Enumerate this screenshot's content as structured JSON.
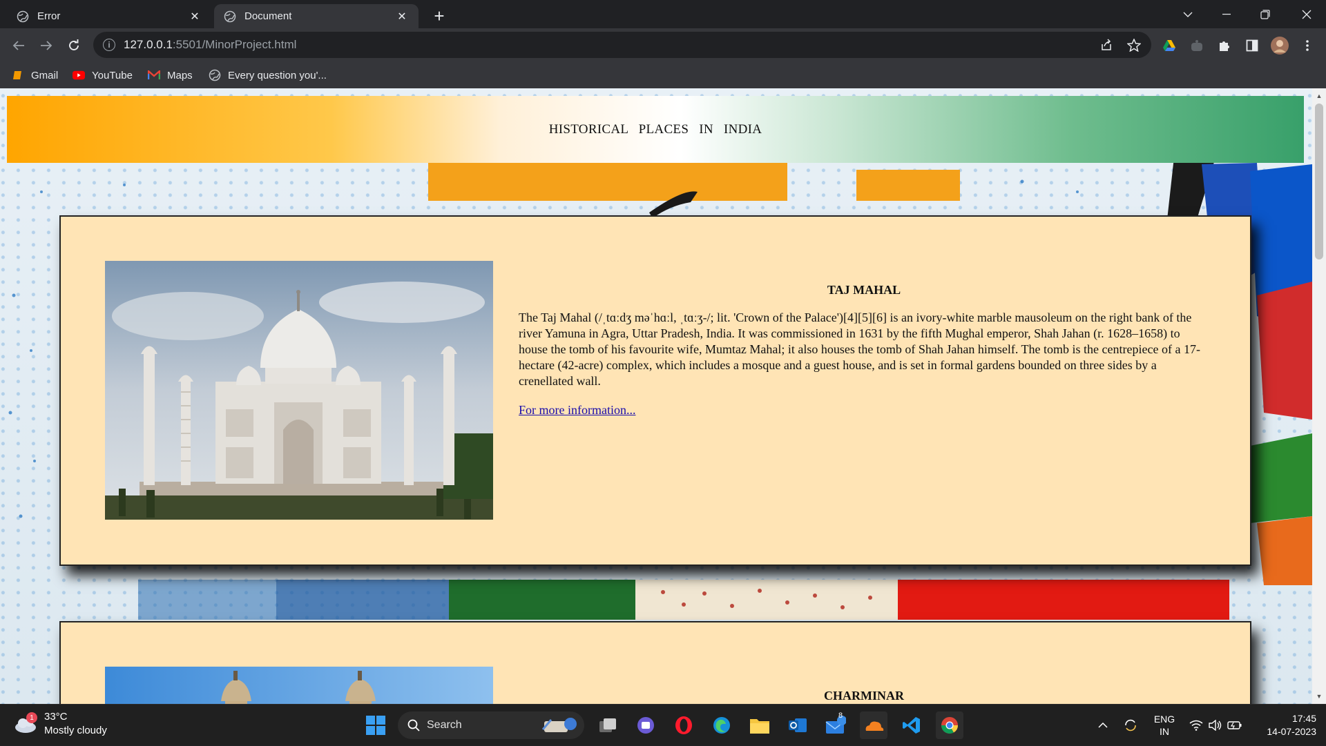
{
  "browser": {
    "tabs": [
      {
        "title": "Error",
        "active": false
      },
      {
        "title": "Document",
        "active": true
      }
    ],
    "url_host": "127.0.0.1",
    "url_path": ":5501/MinorProject.html",
    "bookmarks": [
      {
        "label": "Gmail",
        "icon": "gmail-icon"
      },
      {
        "label": "YouTube",
        "icon": "youtube-icon"
      },
      {
        "label": "Maps",
        "icon": "maps-icon"
      },
      {
        "label": "Every question you'...",
        "icon": "globe-icon"
      }
    ]
  },
  "page": {
    "header_title": "HISTORICAL PLACES IN INDIA",
    "cards": [
      {
        "title": "TAJ MAHAL",
        "body": "The Taj Mahal (/ˌtɑːdʒ məˈhɑːl, ˌtɑːʒ-/; lit. 'Crown of the Palace')[4][5][6] is an ivory-white marble mausoleum on the right bank of the river Yamuna in Agra, Uttar Pradesh, India. It was commissioned in 1631 by the fifth Mughal emperor, Shah Jahan (r. 1628–1658) to house the tomb of his favourite wife, Mumtaz Mahal; it also houses the tomb of Shah Jahan himself. The tomb is the centrepiece of a 17-hectare (42-acre) complex, which includes a mosque and a guest house, and is set in formal gardens bounded on three sides by a crenellated wall.",
        "link": "For more information..."
      },
      {
        "title": "CHARMINAR"
      }
    ]
  },
  "taskbar": {
    "weather_temp": "33°C",
    "weather_desc": "Mostly cloudy",
    "weather_badge": "1",
    "search_label": "Search",
    "mail_badge": "8",
    "lang_top": "ENG",
    "lang_bottom": "IN",
    "time": "17:45",
    "date": "14-07-2023"
  },
  "colors": {
    "card_bg": "#ffe4b5",
    "link": "#1a0dab",
    "header_left": "#ffa500",
    "header_right": "#38a06a"
  }
}
